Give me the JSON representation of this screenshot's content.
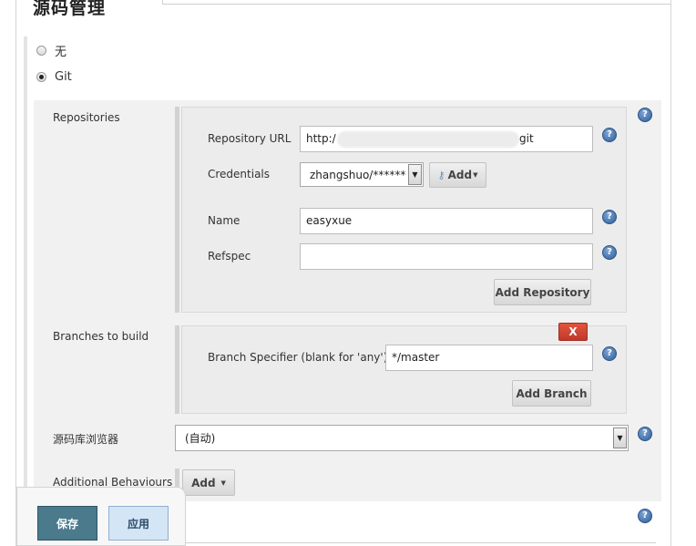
{
  "section": {
    "title": "源码管理"
  },
  "scm_options": [
    {
      "label": "无",
      "selected": false
    },
    {
      "label": "Git",
      "selected": true
    }
  ],
  "repositories": {
    "label": "Repositories",
    "url_label": "Repository URL",
    "url_prefix": "http:/",
    "url_suffix": "git",
    "credentials_label": "Credentials",
    "credentials_value": "zhangshuo/******",
    "add_button": "Add",
    "name_label": "Name",
    "name_value": "easyxue",
    "refspec_label": "Refspec",
    "refspec_value": "",
    "add_repository_button": "Add Repository"
  },
  "branches": {
    "label": "Branches to build",
    "delete_button": "X",
    "specifier_label": "Branch Specifier (blank for 'any')",
    "specifier_value": "*/master",
    "add_branch_button": "Add Branch"
  },
  "browser": {
    "label": "源码库浏览器",
    "value": "(自动)"
  },
  "additional": {
    "label": "Additional Behaviours",
    "add_button": "Add"
  },
  "footer": {
    "save_button": "保存",
    "apply_button": "应用"
  },
  "icons": {
    "help": "help-icon",
    "key": "key-icon",
    "dropdown": "chevron-down-icon"
  },
  "colors": {
    "delete_red": "#d9442f",
    "help_blue": "#2f5e98",
    "save_primary": "#4a7a8c",
    "apply_secondary": "#d4e5f5"
  }
}
